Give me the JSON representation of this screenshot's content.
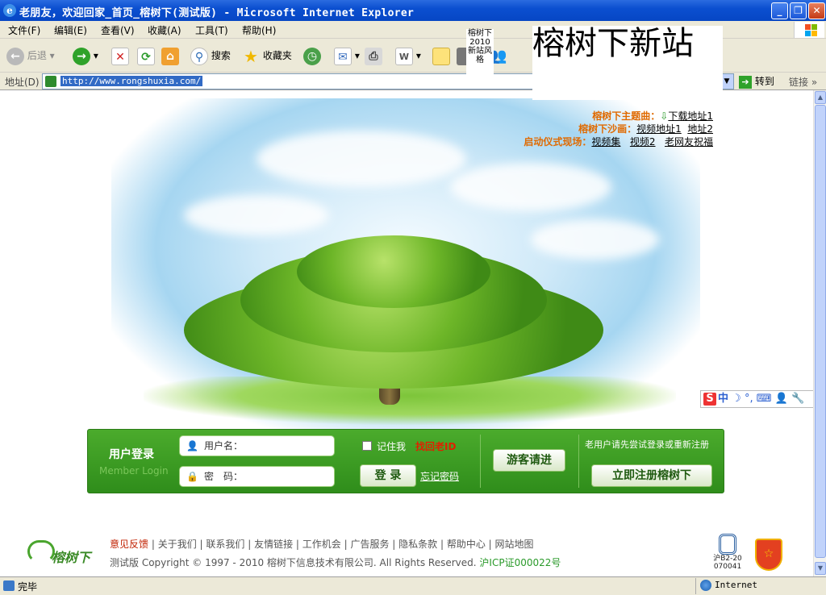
{
  "window": {
    "title": "老朋友，欢迎回家_首页_榕树下(测试版) - Microsoft Internet Explorer",
    "min_label": "_",
    "max_label": "❐",
    "close_label": "✕"
  },
  "menu": [
    "文件(F)",
    "编辑(E)",
    "查看(V)",
    "收藏(A)",
    "工具(T)",
    "帮助(H)"
  ],
  "toolbar": {
    "back": "后退",
    "search": "搜索",
    "favorites": "收藏夹"
  },
  "address": {
    "label": "地址(D)",
    "url": "http://www.rongshuxia.com/",
    "go": "转到",
    "links": "链接"
  },
  "overlay": {
    "small_text": "榕树下2010新站风格",
    "big_text": "榕树下新站"
  },
  "promo": {
    "line1_label": "榕树下主题曲：",
    "line1_link": "下载地址1",
    "line2_label": "榕树下沙画：",
    "line2_link1": "视频地址1",
    "line2_link2": "地址2",
    "line3_label": "启动仪式现场：",
    "line3_link1": "视频集",
    "line3_link2": "视频2",
    "line3_link3": "老网友祝福"
  },
  "ime": {
    "cn": "中"
  },
  "login": {
    "title": "用户登录",
    "subtitle": "Member Login",
    "username_placeholder": "用户名：",
    "password_placeholder": "密　码：",
    "remember": "记住我",
    "recover": "找回老ID",
    "login_button": "登 录",
    "forgot": "忘记密码",
    "guest_button": "游客请进",
    "notice": "老用户请先尝试登录或重新注册",
    "register_button": "立即注册榕树下"
  },
  "footer": {
    "links": [
      "意见反馈",
      "关于我们",
      "联系我们",
      "友情链接",
      "工作机会",
      "广告服务",
      "隐私条款",
      "帮助中心",
      "网站地图"
    ],
    "copyright": "测试版  Copyright © 1997 - 2010 榕树下信息技术有限公司. All Rights Reserved.",
    "icp": "沪ICP证000022号",
    "logo_text": "榕树下",
    "badge_text": "沪B2-20070041"
  },
  "status": {
    "left": "完毕",
    "zone": "Internet"
  },
  "colors": {
    "title_blue": "#0b4fd0",
    "login_green": "#3a9a22",
    "promo_orange": "#e06a00",
    "recover_red": "#e02000"
  }
}
